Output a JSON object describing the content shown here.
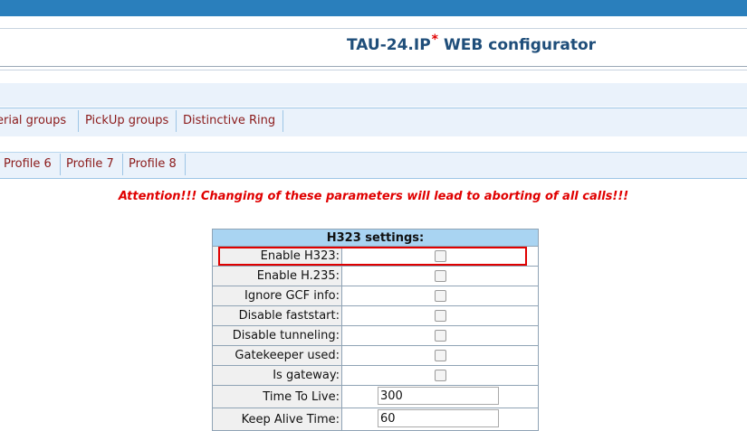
{
  "app": {
    "title": "TAU-24.IP",
    "title_star": "*",
    "title_suffix": "WEB configurator"
  },
  "menu_row_1": [
    {
      "label": "erial groups"
    },
    {
      "label": "PickUp groups"
    },
    {
      "label": "Distinctive Ring"
    }
  ],
  "menu_row_2": [
    {
      "label": "Profile 6"
    },
    {
      "label": "Profile 7"
    },
    {
      "label": "Profile 8"
    }
  ],
  "attention": "Attention!!! Changing of these parameters will lead to aborting of all calls!!!",
  "settings": {
    "header": "H323 settings:",
    "checkbox_rows": [
      {
        "label": "Enable H323:",
        "checked": false
      },
      {
        "label": "Enable H.235:",
        "checked": false
      },
      {
        "label": "Ignore GCF info:",
        "checked": false
      },
      {
        "label": "Disable faststart:",
        "checked": false
      },
      {
        "label": "Disable tunneling:",
        "checked": false
      },
      {
        "label": "Gatekeeper used:",
        "checked": false
      },
      {
        "label": "Is gateway:",
        "checked": false
      }
    ],
    "ttl": {
      "label": "Time To Live:",
      "value": "300"
    },
    "keepalive": {
      "label": "Keep Alive Time:",
      "value": "60"
    }
  },
  "colors": {
    "topbar": "#2a7fbc",
    "title_text": "#1f4e7a",
    "menu_link": "#8b1a1a",
    "attention": "#e00000",
    "table_header": "#a9d4f2",
    "highlight": "#e00000"
  }
}
